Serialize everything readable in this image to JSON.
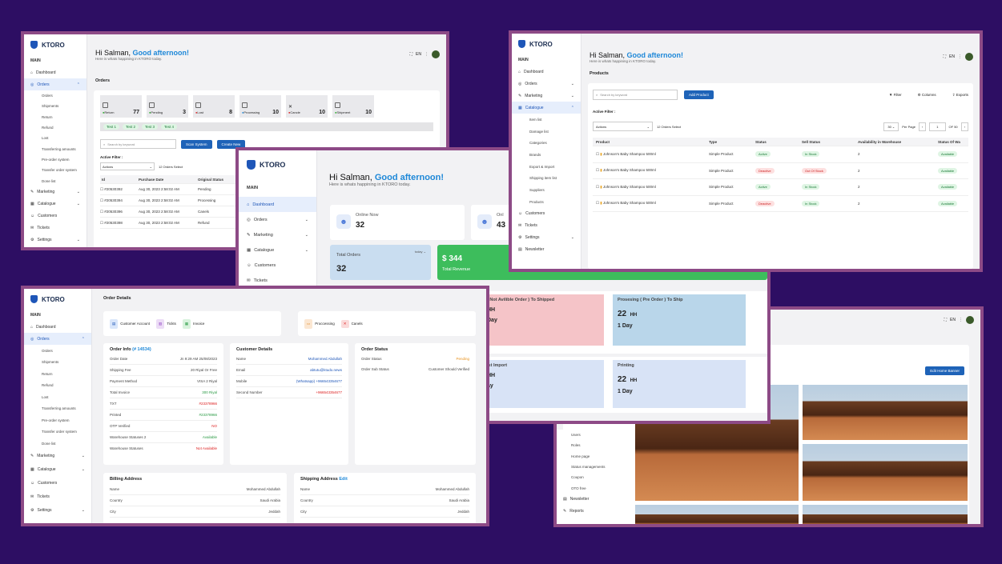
{
  "brand": "KTORO",
  "main_label": "MAIN",
  "greeting": {
    "hi": "Hi Salman,",
    "good": "Good afternoon!",
    "sub": "Here is whats happining in KTORO today."
  },
  "lang": "EN",
  "w1": {
    "title": "Orders",
    "nav": [
      "Dashboard",
      "Orders",
      "Marketing",
      "Catalogue",
      "Customers",
      "Tickets",
      "Settings"
    ],
    "subnav": [
      "Orders",
      "Shipments",
      "Return",
      "Refund",
      "Lost",
      "Transferring amounts",
      "Pre-order system",
      "Transfer order system",
      "Done list"
    ],
    "stats": [
      {
        "label": "Return",
        "v": "77"
      },
      {
        "label": "Pending",
        "v": "3"
      },
      {
        "label": "Lost",
        "v": "8"
      },
      {
        "label": "Processing",
        "v": "10"
      },
      {
        "label": "Cancle",
        "v": "10"
      },
      {
        "label": "Shipment",
        "v": "10"
      }
    ],
    "tests": [
      "Test 1",
      "Test 2",
      "Test 3",
      "Test 4"
    ],
    "search": "Search by keyword",
    "btn1": "Scan System",
    "btn2": "Create New",
    "active_filter": "Active Filter :",
    "actions": "Actions",
    "selected": "12 Orders Select",
    "cols": [
      "Id",
      "Purchase Date",
      "Original Status"
    ],
    "rows": [
      [
        "#20530392",
        "Aug 30, 2023 2:58:02 AM",
        "Pending"
      ],
      [
        "#20530394",
        "Aug 30, 2023 2:58:02 AM",
        "Processing"
      ],
      [
        "#20530396",
        "Aug 30, 2023 2:58:02 AM",
        "Canels"
      ],
      [
        "#20530398",
        "Aug 30, 2023 2:58:02 AM",
        "Refund"
      ]
    ]
  },
  "w2": {
    "title": "Products",
    "nav": [
      "Dashboard",
      "Orders",
      "Marketing",
      "Catalogue"
    ],
    "subnav": [
      "Item list",
      "Damage list",
      "Categories",
      "Brands",
      "Export & Import",
      "Shipping item list",
      "Suppliers",
      "Products"
    ],
    "nav2": [
      "Customers",
      "Tickets",
      "Settings",
      "Newsletter"
    ],
    "search": "Search by keyword",
    "add": "Add Product",
    "filter": "Filter",
    "columns": "Columns",
    "exports": "Exports",
    "active_filter": "Active Filter :",
    "actions": "Actions",
    "selected": "12 Orders Select",
    "per_page_val": "30",
    "per_page": "Per Page",
    "page": "1",
    "of": "OF 50",
    "cols": [
      "Product",
      "Type",
      "Status",
      "Sell Status",
      "Availability in Warehouse",
      "Status Of Wa"
    ],
    "rows": [
      {
        "name": "Johnson's Baby Shampoo 500ml",
        "type": "Simple Product",
        "status": "Active",
        "sell": "In Stock",
        "qty": "2",
        "av": "Available"
      },
      {
        "name": "Johnson's Baby Shampoo 500ml",
        "type": "Simple Product",
        "status": "Deactive",
        "sell": "Out Of Stock",
        "qty": "2",
        "av": "Available"
      },
      {
        "name": "Johnson's Baby Shampoo 500ml",
        "type": "Simple Product",
        "status": "Active",
        "sell": "In Stock",
        "qty": "2",
        "av": "Available"
      },
      {
        "name": "Johnson's Baby Shampoo 500ml",
        "type": "Simple Product",
        "status": "Deactive",
        "sell": "In Stock",
        "qty": "2",
        "av": "Available"
      }
    ]
  },
  "w3": {
    "nav": [
      "Dashboard",
      "Orders",
      "Marketing",
      "Catalogue",
      "Customers",
      "Tickets"
    ],
    "online": {
      "label": "Online Now",
      "v": "32"
    },
    "online2": {
      "label": "Onl",
      "v": "43"
    },
    "total_orders": {
      "label": "Total Orders",
      "v": "32",
      "sel": "today"
    },
    "revenue": {
      "v": "$ 344",
      "label": "Total Revenue"
    },
    "kpi": [
      {
        "t": "( Not Avilible Order ) To Shipped",
        "v": "HH",
        "d": "Day"
      },
      {
        "t": "Prosesing ( Pre Order ) To Ship",
        "v": "22",
        "u": "HH",
        "d": "1 Day"
      },
      {
        "t": "ist Import",
        "v": "HH",
        "d": "ay"
      },
      {
        "t": "Printing",
        "v": "22",
        "u": "HH",
        "d": "1 Day"
      }
    ]
  },
  "w4": {
    "title": "Order Details",
    "nav": [
      "Dashboard",
      "Orders",
      "Marketing",
      "Catalogue",
      "Customers",
      "Tickets",
      "Settings"
    ],
    "subnav": [
      "Orders",
      "Shipments",
      "Return",
      "Refund",
      "Lost",
      "Transferring amounts",
      "Pre-order system",
      "Transfer order system",
      "Done list"
    ],
    "chips": [
      "Customer Account",
      "Tickts",
      "Invoice"
    ],
    "chips2": [
      "Proccessing",
      "Canels"
    ],
    "info_title": "Order Info",
    "order_no": "(# 14534)",
    "info": [
      [
        "Order Date",
        "Jn 9:29 AM 25/08/2023"
      ],
      [
        "Shipping Fee",
        "20 Riyal Or Free"
      ],
      [
        "Payment Method",
        "VISA 2 Riyal"
      ],
      [
        "Total Invoice",
        "300 Riyal"
      ],
      [
        "TXT",
        "#23378966"
      ],
      [
        "Printed",
        "#23378966"
      ],
      [
        "OTP Verified",
        "NO"
      ],
      [
        "Warehouse Statuses 2",
        "Available"
      ],
      [
        "Warehouse Statuses",
        "Not Available"
      ]
    ],
    "cust_title": "Customer Details",
    "cust": [
      [
        "Name",
        "Mohammed Abdullah"
      ],
      [
        "Email",
        "abtutu@ktudo.news"
      ],
      [
        "Mobile",
        "(Whatsapp) +966543354677"
      ],
      [
        "Second Number",
        "+966543354677"
      ]
    ],
    "status_title": "Order Status",
    "status": [
      [
        "Order Status",
        "Pending"
      ],
      [
        "Order Sub Status",
        "Customer Should Verified"
      ]
    ],
    "billing_title": "Billing Address",
    "shipping_title": "Shipping Address",
    "edit": "Edit",
    "addr": [
      [
        "Name",
        "Mohammed Abdullah"
      ],
      [
        "Country",
        "Saudi Arabia"
      ],
      [
        "City",
        "Jeddah"
      ]
    ]
  },
  "w5": {
    "subnav": [
      "Users",
      "Roles",
      "Home page",
      "Status managements",
      "Coupon",
      "OTO free"
    ],
    "nav": [
      "Newsletter",
      "Reports"
    ],
    "btn": "Edit Home Banner"
  }
}
